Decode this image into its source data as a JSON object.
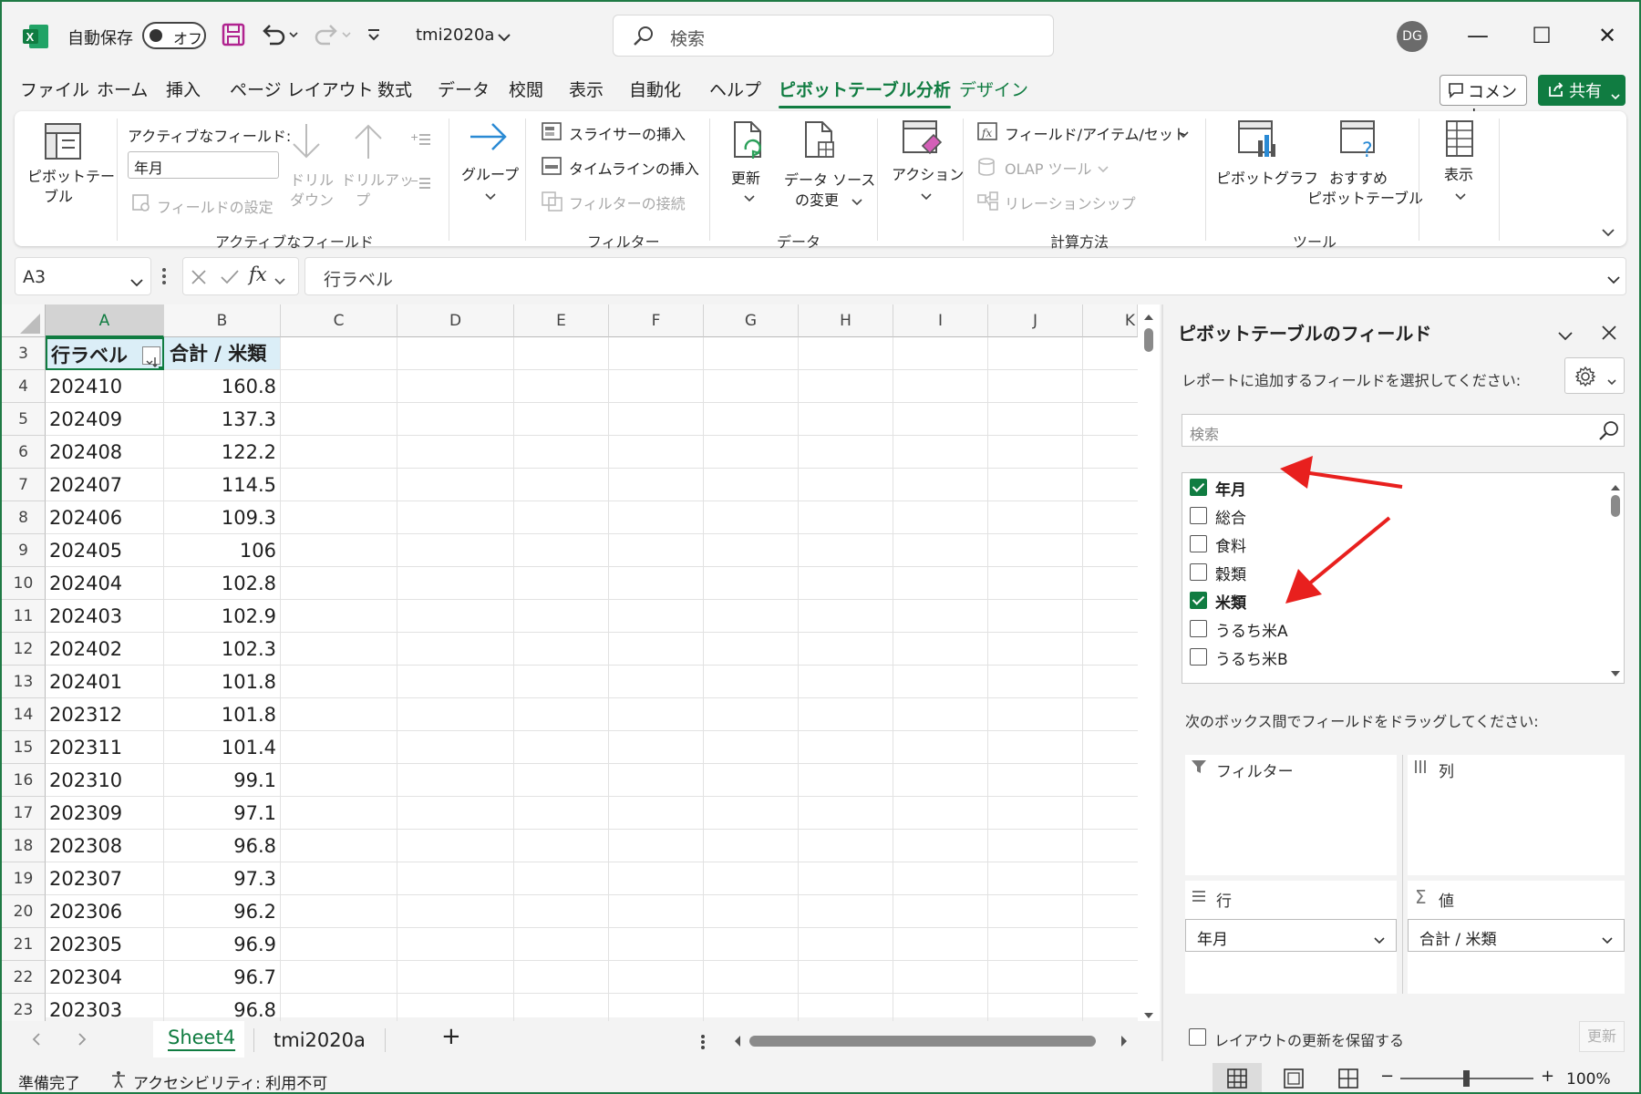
{
  "titlebar": {
    "autosave_label": "自動保存",
    "autosave_state": "オフ",
    "filename": "tmi2020a",
    "search_placeholder": "検索",
    "user_initials": "DG",
    "minimize": "—",
    "maximize": "☐",
    "close": "✕"
  },
  "menu": {
    "items": [
      "ファイル",
      "ホーム",
      "挿入",
      "ページ レイアウト",
      "数式",
      "データ",
      "校閲",
      "表示",
      "自動化",
      "ヘルプ",
      "ピボットテーブル分析",
      "デザイン"
    ],
    "comment": "コメント",
    "share": "共有"
  },
  "ribbon": {
    "pivot_table": "ピボットテー",
    "pivot_table2": "ブル",
    "active_field_label": "アクティブなフィールド:",
    "active_field_value": "年月",
    "field_settings": "フィールドの設定",
    "drill_down1": "ドリル",
    "drill_down2": "ダウン",
    "drill_up1": "ドリルアッ",
    "drill_up2": "プ",
    "group_active_field": "アクティブなフィールド",
    "group_btn": "グループ",
    "insert_slicer": "スライサーの挿入",
    "insert_timeline": "タイムラインの挿入",
    "filter_connections": "フィルターの接続",
    "group_filter": "フィルター",
    "refresh": "更新",
    "change_source1": "データ ソース",
    "change_source2": "の変更",
    "group_data": "データ",
    "actions": "アクション",
    "fields_items_sets": "フィールド/アイテム/セット",
    "olap_tools": "OLAP ツール",
    "relationships": "リレーションシップ",
    "group_calc": "計算方法",
    "pivot_chart": "ピボットグラフ",
    "recommended1": "おすすめ",
    "recommended2": "ピボットテーブル",
    "group_tools": "ツール",
    "show": "表示"
  },
  "formula": {
    "namebox": "A3",
    "content": "行ラベル"
  },
  "grid": {
    "columns": [
      "A",
      "B",
      "C",
      "D",
      "E",
      "F",
      "G",
      "H",
      "I",
      "J",
      "K"
    ],
    "header_row": {
      "row": "3",
      "a": "行ラベル",
      "b": "合計 / 米類"
    },
    "rows": [
      {
        "row": "4",
        "a": "202410",
        "b": "160.8"
      },
      {
        "row": "5",
        "a": "202409",
        "b": "137.3"
      },
      {
        "row": "6",
        "a": "202408",
        "b": "122.2"
      },
      {
        "row": "7",
        "a": "202407",
        "b": "114.5"
      },
      {
        "row": "8",
        "a": "202406",
        "b": "109.3"
      },
      {
        "row": "9",
        "a": "202405",
        "b": "106"
      },
      {
        "row": "10",
        "a": "202404",
        "b": "102.8"
      },
      {
        "row": "11",
        "a": "202403",
        "b": "102.9"
      },
      {
        "row": "12",
        "a": "202402",
        "b": "102.3"
      },
      {
        "row": "13",
        "a": "202401",
        "b": "101.8"
      },
      {
        "row": "14",
        "a": "202312",
        "b": "101.8"
      },
      {
        "row": "15",
        "a": "202311",
        "b": "101.4"
      },
      {
        "row": "16",
        "a": "202310",
        "b": "99.1"
      },
      {
        "row": "17",
        "a": "202309",
        "b": "97.1"
      },
      {
        "row": "18",
        "a": "202308",
        "b": "96.8"
      },
      {
        "row": "19",
        "a": "202307",
        "b": "97.3"
      },
      {
        "row": "20",
        "a": "202306",
        "b": "96.2"
      },
      {
        "row": "21",
        "a": "202305",
        "b": "96.9"
      },
      {
        "row": "22",
        "a": "202304",
        "b": "96.7"
      },
      {
        "row": "23",
        "a": "202303",
        "b": "96.8"
      }
    ]
  },
  "sheets": {
    "tabs": [
      "Sheet4",
      "tmi2020a"
    ],
    "active": "Sheet4",
    "add": "+"
  },
  "status": {
    "ready": "準備完了",
    "accessibility": "アクセシビリティ: 利用不可",
    "zoom": "100%"
  },
  "pivot_panel": {
    "title": "ピボットテーブルのフィールド",
    "instruction": "レポートに追加するフィールドを選択してください:",
    "search_placeholder": "検索",
    "fields": [
      {
        "label": "年月",
        "checked": true
      },
      {
        "label": "総合",
        "checked": false
      },
      {
        "label": "食料",
        "checked": false
      },
      {
        "label": "穀類",
        "checked": false
      },
      {
        "label": "米類",
        "checked": true
      },
      {
        "label": "うるち米A",
        "checked": false
      },
      {
        "label": "うるち米B",
        "checked": false
      }
    ],
    "drag_instruction": "次のボックス間でフィールドをドラッグしてください:",
    "filter_area": "フィルター",
    "columns_area": "列",
    "rows_area": "行",
    "values_area": "値",
    "rows_item": "年月",
    "values_item": "合計 / 米類",
    "defer_label": "レイアウトの更新を保留する",
    "update_button": "更新"
  },
  "colors": {
    "accent": "#107c41",
    "arrow": "#e8201e"
  }
}
